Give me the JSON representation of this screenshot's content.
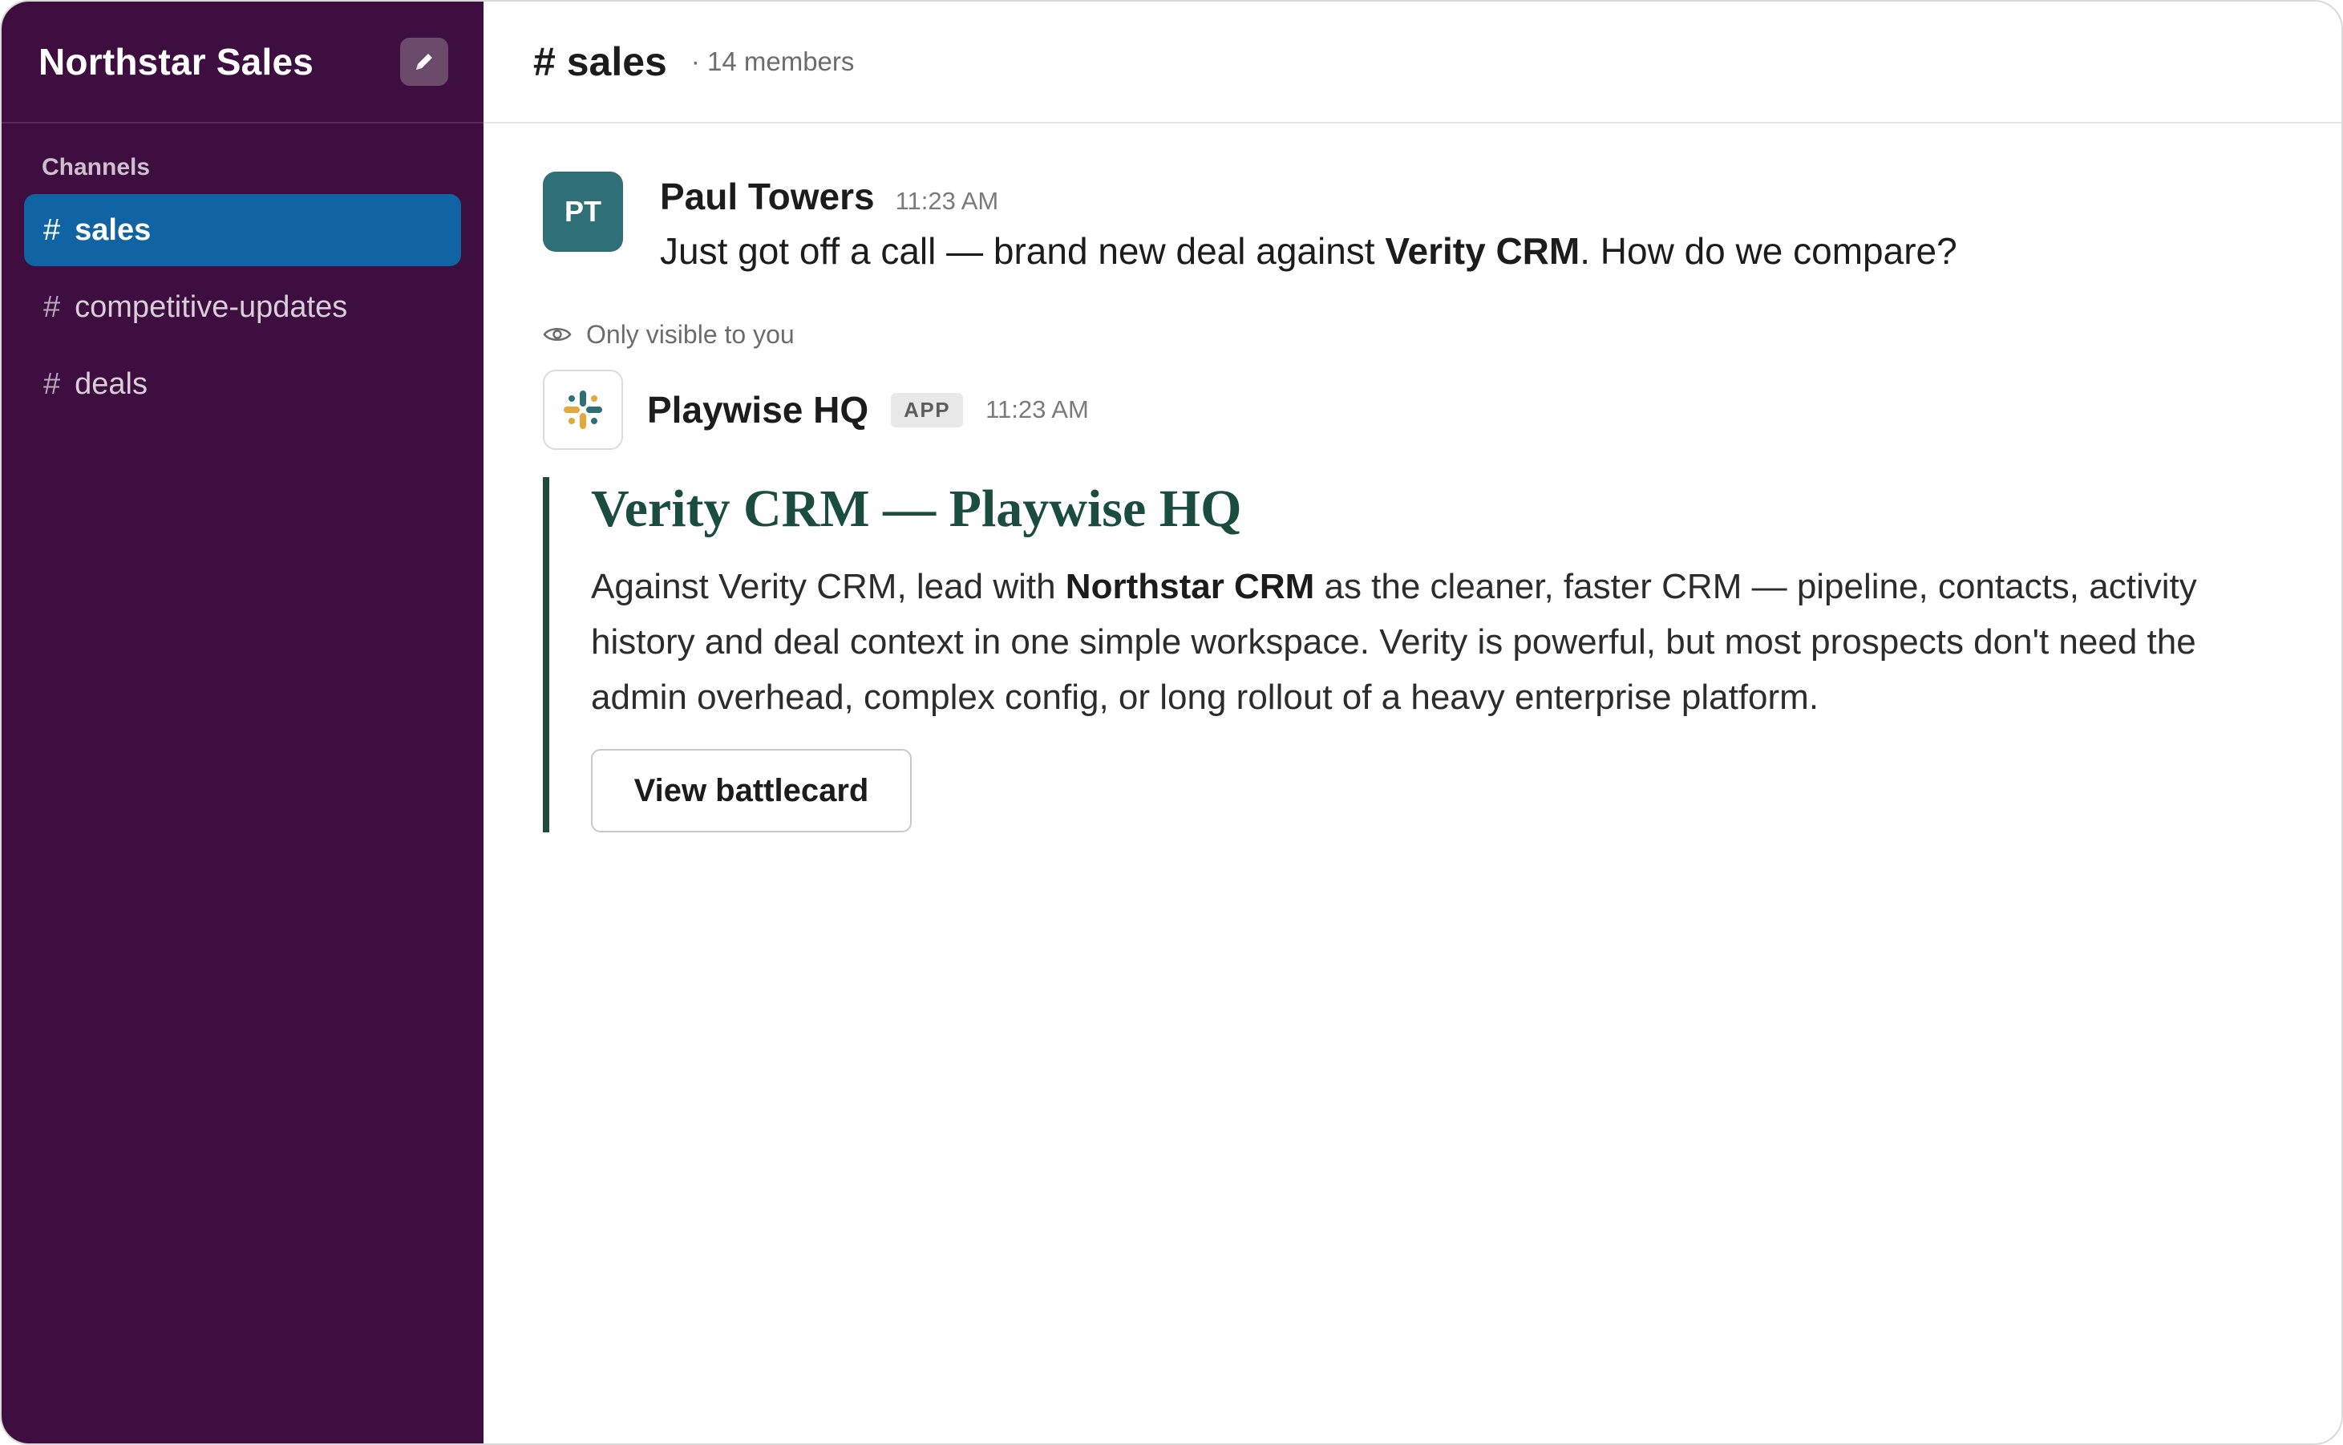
{
  "workspace": {
    "name": "Northstar Sales",
    "compose_icon": "pencil-icon"
  },
  "sidebar": {
    "section_label": "Channels",
    "channels": [
      {
        "hash": "#",
        "name": "sales",
        "active": true
      },
      {
        "hash": "#",
        "name": "competitive-updates",
        "active": false
      },
      {
        "hash": "#",
        "name": "deals",
        "active": false
      }
    ]
  },
  "channel_header": {
    "title": "# sales",
    "members": "· 14 members"
  },
  "messages": {
    "user_message": {
      "avatar_initials": "PT",
      "author": "Paul Towers",
      "time": "11:23 AM",
      "text_before": "Just got off a call — brand new deal against ",
      "text_bold": "Verity CRM",
      "text_after": ". How do we compare?"
    },
    "ephemeral_notice": "Only visible to you",
    "app_message": {
      "author": "Playwise HQ",
      "badge": "APP",
      "time": "11:23 AM",
      "attachment": {
        "title": "Verity CRM — Playwise HQ",
        "text_before": "Against Verity CRM, lead with ",
        "text_bold": "Northstar CRM",
        "text_after": " as the cleaner, faster CRM — pipeline, contacts, activity history and deal context in one simple workspace. Verity is powerful, but most prospects don't need the admin overhead, complex config, or long rollout of a heavy enterprise platform.",
        "button_label": "View battlecard"
      }
    }
  },
  "colors": {
    "sidebar_bg": "#3f0e40",
    "active_channel": "#1164a3",
    "avatar_bg": "#2f6f78",
    "attachment_accent": "#1b4d3e"
  }
}
